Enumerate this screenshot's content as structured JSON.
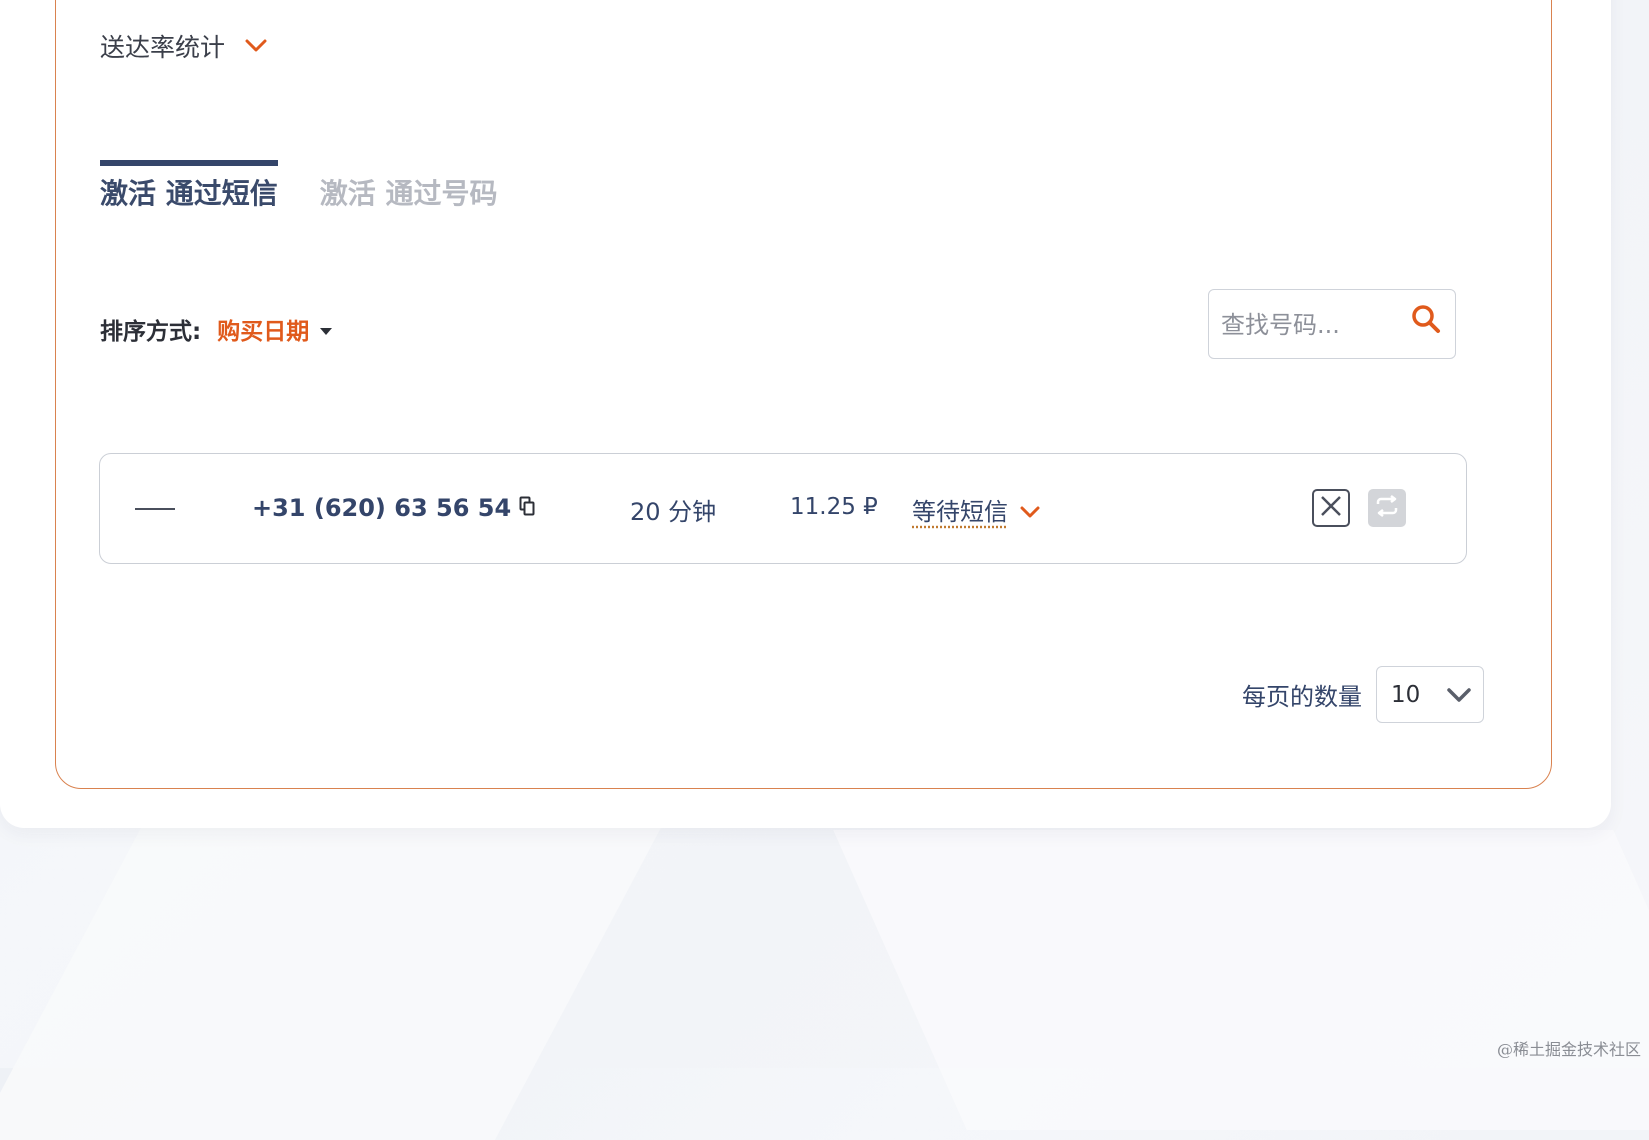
{
  "stats": {
    "title": "送达率统计"
  },
  "tabs": [
    {
      "label": "激活 通过短信",
      "active": true
    },
    {
      "label": "激活 通过号码",
      "active": false
    }
  ],
  "sort": {
    "label": "排序方式:",
    "value": "购买日期"
  },
  "search": {
    "placeholder": "查找号码..."
  },
  "activation": {
    "phone": "+31 (620) 63 56 54",
    "time": "20 分钟",
    "price": "11.25 ₽",
    "status": "等待短信"
  },
  "pagination": {
    "label": "每页的数量",
    "value": "10"
  },
  "watermark": "@稀土掘金技术社区",
  "colors": {
    "accent": "#e05a1c",
    "primary_text": "#34456a",
    "card_border": "#d9824f"
  }
}
